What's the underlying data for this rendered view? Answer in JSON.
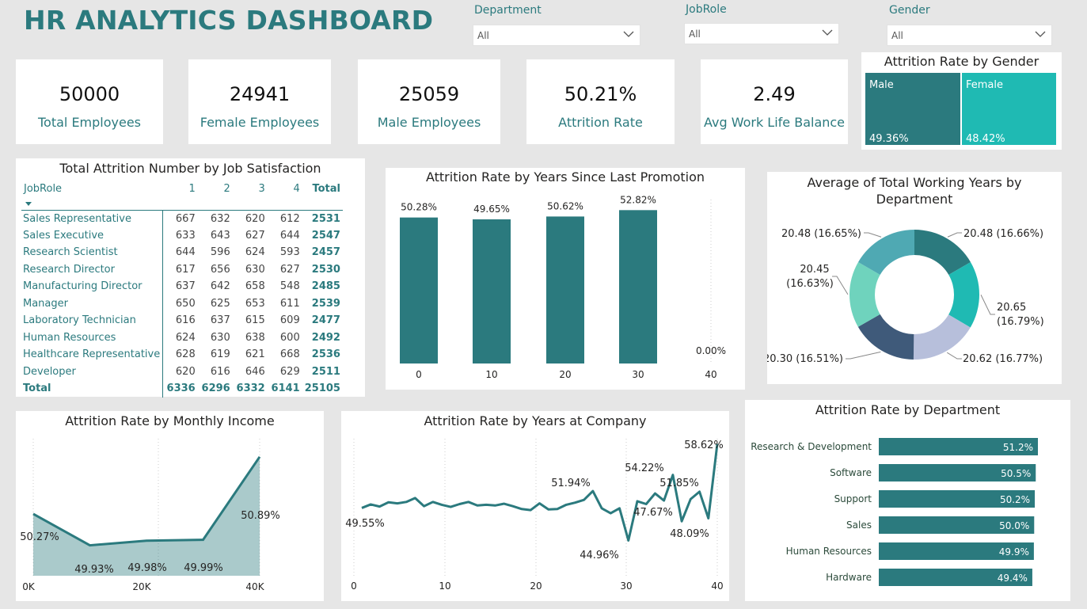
{
  "header": {
    "title": "HR ANALYTICS DASHBOARD"
  },
  "slicers": [
    {
      "label": "Department",
      "value": "All"
    },
    {
      "label": "JobRole",
      "value": "All"
    },
    {
      "label": "Gender",
      "value": "All"
    }
  ],
  "kpis": [
    {
      "value": "50000",
      "label": "Total Employees"
    },
    {
      "value": "24941",
      "label": "Female Employees"
    },
    {
      "value": "25059",
      "label": "Male Employees"
    },
    {
      "value": "50.21%",
      "label": "Attrition Rate"
    },
    {
      "value": "2.49",
      "label": "Avg Work Life Balance"
    }
  ],
  "matrix": {
    "title": "Total Attrition Number by Job Satisfaction",
    "headers": [
      "JobRole",
      "1",
      "2",
      "3",
      "4",
      "Total"
    ],
    "rows": [
      [
        "Sales Representative",
        "667",
        "632",
        "620",
        "612",
        "2531"
      ],
      [
        "Sales Executive",
        "633",
        "643",
        "627",
        "644",
        "2547"
      ],
      [
        "Research Scientist",
        "644",
        "596",
        "624",
        "593",
        "2457"
      ],
      [
        "Research Director",
        "617",
        "656",
        "630",
        "627",
        "2530"
      ],
      [
        "Manufacturing Director",
        "637",
        "642",
        "658",
        "548",
        "2485"
      ],
      [
        "Manager",
        "650",
        "625",
        "653",
        "611",
        "2539"
      ],
      [
        "Laboratory Technician",
        "616",
        "637",
        "615",
        "609",
        "2477"
      ],
      [
        "Human Resources",
        "624",
        "630",
        "638",
        "600",
        "2492"
      ],
      [
        "Healthcare Representative",
        "628",
        "619",
        "621",
        "668",
        "2536"
      ],
      [
        "Developer",
        "620",
        "616",
        "646",
        "629",
        "2511"
      ]
    ],
    "total": [
      "Total",
      "6336",
      "6296",
      "6332",
      "6141",
      "25105"
    ]
  },
  "chart_data": [
    {
      "id": "gender",
      "type": "treemap",
      "title": "Attrition Rate by Gender",
      "categories": [
        "Male",
        "Female"
      ],
      "values": [
        49.36,
        48.42
      ],
      "labels": [
        "49.36%",
        "48.42%"
      ],
      "colors": [
        "#2b7a7e",
        "#1fbab3"
      ]
    },
    {
      "id": "promotion",
      "type": "bar",
      "title": "Attrition Rate by Years Since Last Promotion",
      "categories": [
        "0",
        "10",
        "20",
        "30",
        "40"
      ],
      "values": [
        50.28,
        49.65,
        50.62,
        52.82,
        0.0
      ],
      "labels": [
        "50.28%",
        "49.65%",
        "50.62%",
        "52.82%",
        "0.00%"
      ],
      "color": "#2b7a7e"
    },
    {
      "id": "workyears",
      "type": "pie",
      "title": "Average of Total Working Years by Department",
      "values": [
        20.48,
        20.65,
        20.62,
        20.3,
        20.45,
        20.48
      ],
      "labels": [
        "20.48 (16.66%)",
        "20.65 (16.79%)",
        "20.62 (16.77%)",
        "20.30 (16.51%)",
        "20.45 (16.63%)",
        "20.48 (16.65%)"
      ],
      "colors": [
        "#2b7a7e",
        "#1fbab3",
        "#b7bfdb",
        "#3f5a7a",
        "#6fd3bd",
        "#4fa9b3"
      ]
    },
    {
      "id": "income",
      "type": "area",
      "title": "Attrition Rate by Monthly Income",
      "x": [
        0,
        10000,
        20000,
        30000,
        40000
      ],
      "y": [
        50.27,
        49.93,
        49.98,
        49.99,
        50.89
      ],
      "labels": [
        "50.27%",
        "49.93%",
        "49.98%",
        "49.99%",
        "50.89%"
      ],
      "xticks": [
        "0K",
        "20K",
        "40K"
      ],
      "color": "#2b7a7e"
    },
    {
      "id": "yearsatcompany",
      "type": "line",
      "title": "Attrition Rate by Years at Company",
      "x": [
        1,
        2,
        3,
        4,
        5,
        6,
        7,
        8,
        9,
        10,
        11,
        12,
        13,
        14,
        15,
        16,
        17,
        18,
        19,
        20,
        21,
        22,
        23,
        24,
        25,
        26,
        27,
        28,
        29,
        30,
        31,
        32,
        33,
        34,
        35,
        36,
        37,
        38,
        39,
        40
      ],
      "y": [
        49.55,
        50.05,
        49.75,
        50.35,
        50.2,
        50.4,
        50.95,
        49.8,
        50.4,
        50.0,
        49.7,
        50.1,
        50.4,
        49.9,
        50.0,
        49.9,
        50.15,
        49.8,
        49.4,
        49.25,
        50.2,
        49.35,
        49.4,
        50.0,
        50.3,
        50.7,
        51.94,
        49.5,
        48.8,
        49.5,
        44.96,
        50.5,
        50.1,
        51.6,
        50.6,
        54.22,
        47.67,
        50.8,
        51.85,
        48.09,
        58.62
      ],
      "labels": [
        "49.55%",
        "51.94%",
        "44.96%",
        "54.22%",
        "47.67%",
        "51.85%",
        "48.09%",
        "58.62%"
      ],
      "xticks": [
        "0",
        "10",
        "20",
        "30",
        "40"
      ],
      "color": "#2b7a7e"
    },
    {
      "id": "department",
      "type": "bar",
      "title": "Attrition Rate by Department",
      "categories": [
        "Research & Development",
        "Software",
        "Support",
        "Sales",
        "Human Resources",
        "Hardware"
      ],
      "values": [
        51.2,
        50.5,
        50.2,
        50.0,
        49.9,
        49.4
      ],
      "labels": [
        "51.2%",
        "50.5%",
        "50.2%",
        "50.0%",
        "49.9%",
        "49.4%"
      ],
      "color": "#2b7a7e"
    }
  ]
}
